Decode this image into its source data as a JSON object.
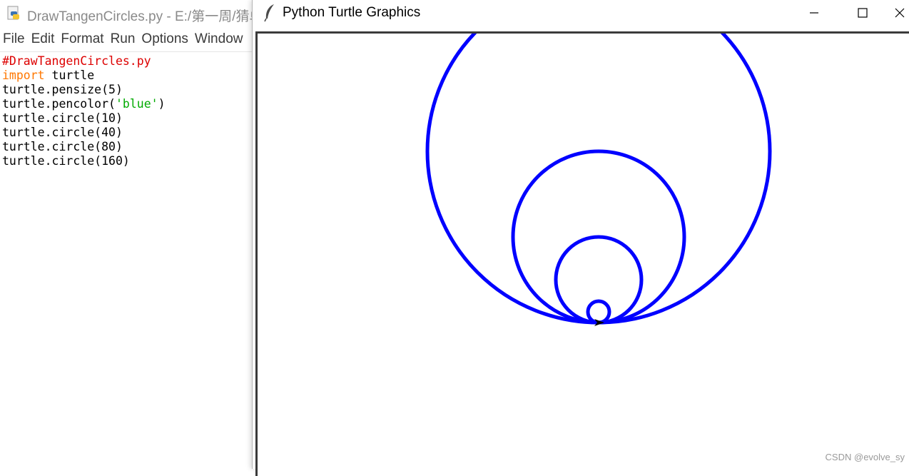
{
  "editor": {
    "title": "DrawTangenCircles.py - E:/第一周/猜单",
    "menu": [
      "File",
      "Edit",
      "Format",
      "Run",
      "Options",
      "Window"
    ],
    "code": {
      "comment": "#DrawTangenCircles.py",
      "import_keyword": "import",
      "import_module": " turtle",
      "pensize": "turtle.pensize(5)",
      "pencolor_prefix": "turtle.pencolor(",
      "pencolor_string": "'blue'",
      "pencolor_suffix": ")",
      "circle_10": "turtle.circle(10)",
      "circle_40": "turtle.circle(40)",
      "circle_80": "turtle.circle(80)",
      "circle_160": "turtle.circle(160)"
    }
  },
  "turtle_window": {
    "title": "Python Turtle Graphics",
    "app_icon": "feather-icon",
    "controls": {
      "minimize": "minimize-icon",
      "maximize": "maximize-icon",
      "close": "close-icon"
    },
    "pen_color": "#0000ff",
    "pen_size": 5,
    "circle_radii": [
      10,
      40,
      80,
      160
    ],
    "scale": 1.5
  },
  "watermark": "CSDN @evolve_sy"
}
